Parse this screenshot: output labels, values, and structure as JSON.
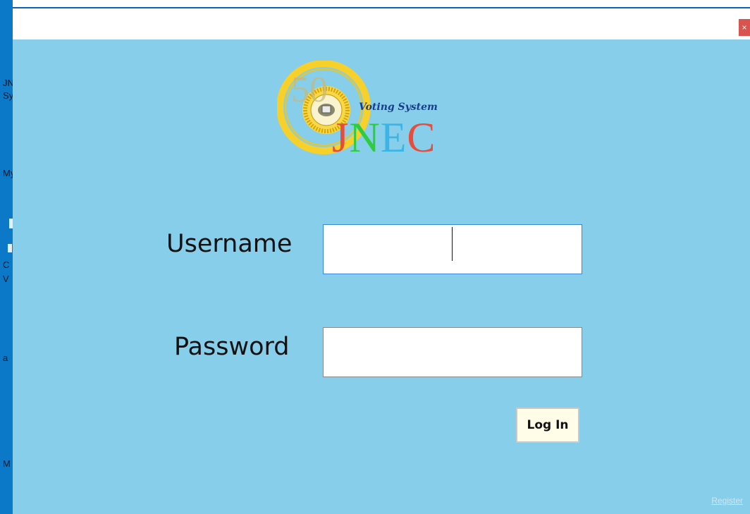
{
  "desktop": {
    "icon_labels": [
      "JN",
      "Sy",
      "My",
      "C",
      "V",
      "a",
      "M"
    ]
  },
  "window": {
    "close_glyph": "×",
    "close_color": "#d9534f",
    "background": "#87ceeb"
  },
  "logo": {
    "tagline": "Voting System",
    "brand_letters": [
      "J",
      "N",
      "E",
      "C"
    ],
    "anniversary_numeral": "50",
    "colors": {
      "J": "#e74c3c",
      "N": "#2ecc40",
      "E": "#3bb4e6",
      "C": "#e74c3c",
      "ring": "#f7d02a"
    }
  },
  "form": {
    "username_label": "Username",
    "username_value": "",
    "password_label": "Password",
    "password_value": "",
    "login_label": "Log In"
  },
  "register": {
    "label": "Register"
  }
}
